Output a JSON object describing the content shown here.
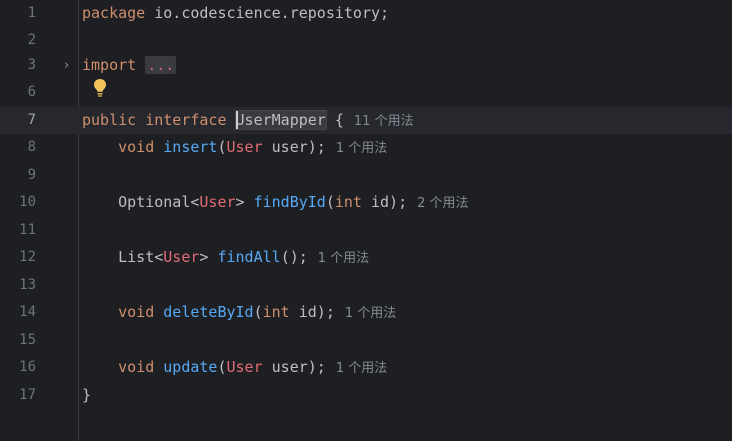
{
  "editor": {
    "lines": [
      {
        "n": "1",
        "package_kw": "package",
        "package_name": " io.codescience.repository;"
      },
      {
        "n": "2"
      },
      {
        "n": "3",
        "import_kw": "import",
        "import_fold": "..."
      },
      {
        "n": "6"
      },
      {
        "n": "7",
        "public_kw": "public",
        "interface_kw": "interface",
        "name": "UserMapper",
        "brace": " {",
        "usages": "11 个用法"
      },
      {
        "n": "8",
        "void_kw": "void",
        "fn": "insert",
        "p1": "(",
        "cls": "User",
        "p2": " user);",
        "usages": "1 个用法"
      },
      {
        "n": "9"
      },
      {
        "n": "10",
        "t1": "Optional<",
        "cls": "User",
        "t2": "> ",
        "fn": "findById",
        "p1": "(",
        "int_kw": "int",
        "p2": " id);",
        "usages": "2 个用法"
      },
      {
        "n": "11"
      },
      {
        "n": "12",
        "t1": "List<",
        "cls": "User",
        "t2": "> ",
        "fn": "findAll",
        "p1": "();",
        "usages": "1 个用法"
      },
      {
        "n": "13"
      },
      {
        "n": "14",
        "void_kw": "void",
        "fn": "deleteById",
        "p1": "(",
        "int_kw": "int",
        "p2": " id);",
        "usages": "1 个用法"
      },
      {
        "n": "15"
      },
      {
        "n": "16",
        "void_kw": "void",
        "fn": "update",
        "p1": "(",
        "cls": "User",
        "p2": " user);",
        "usages": "1 个用法"
      },
      {
        "n": "17",
        "close": "}"
      }
    ]
  },
  "icons": {
    "fold": "chevron-right-icon",
    "intention": "lightbulb-icon"
  },
  "colors": {
    "background": "#1e1f22",
    "current_line": "#26282e",
    "keyword": "#cf8e6d",
    "function": "#56a8f5",
    "class_ref": "#e06c75",
    "hint": "#868a91",
    "bulb": "#f2c55c"
  }
}
